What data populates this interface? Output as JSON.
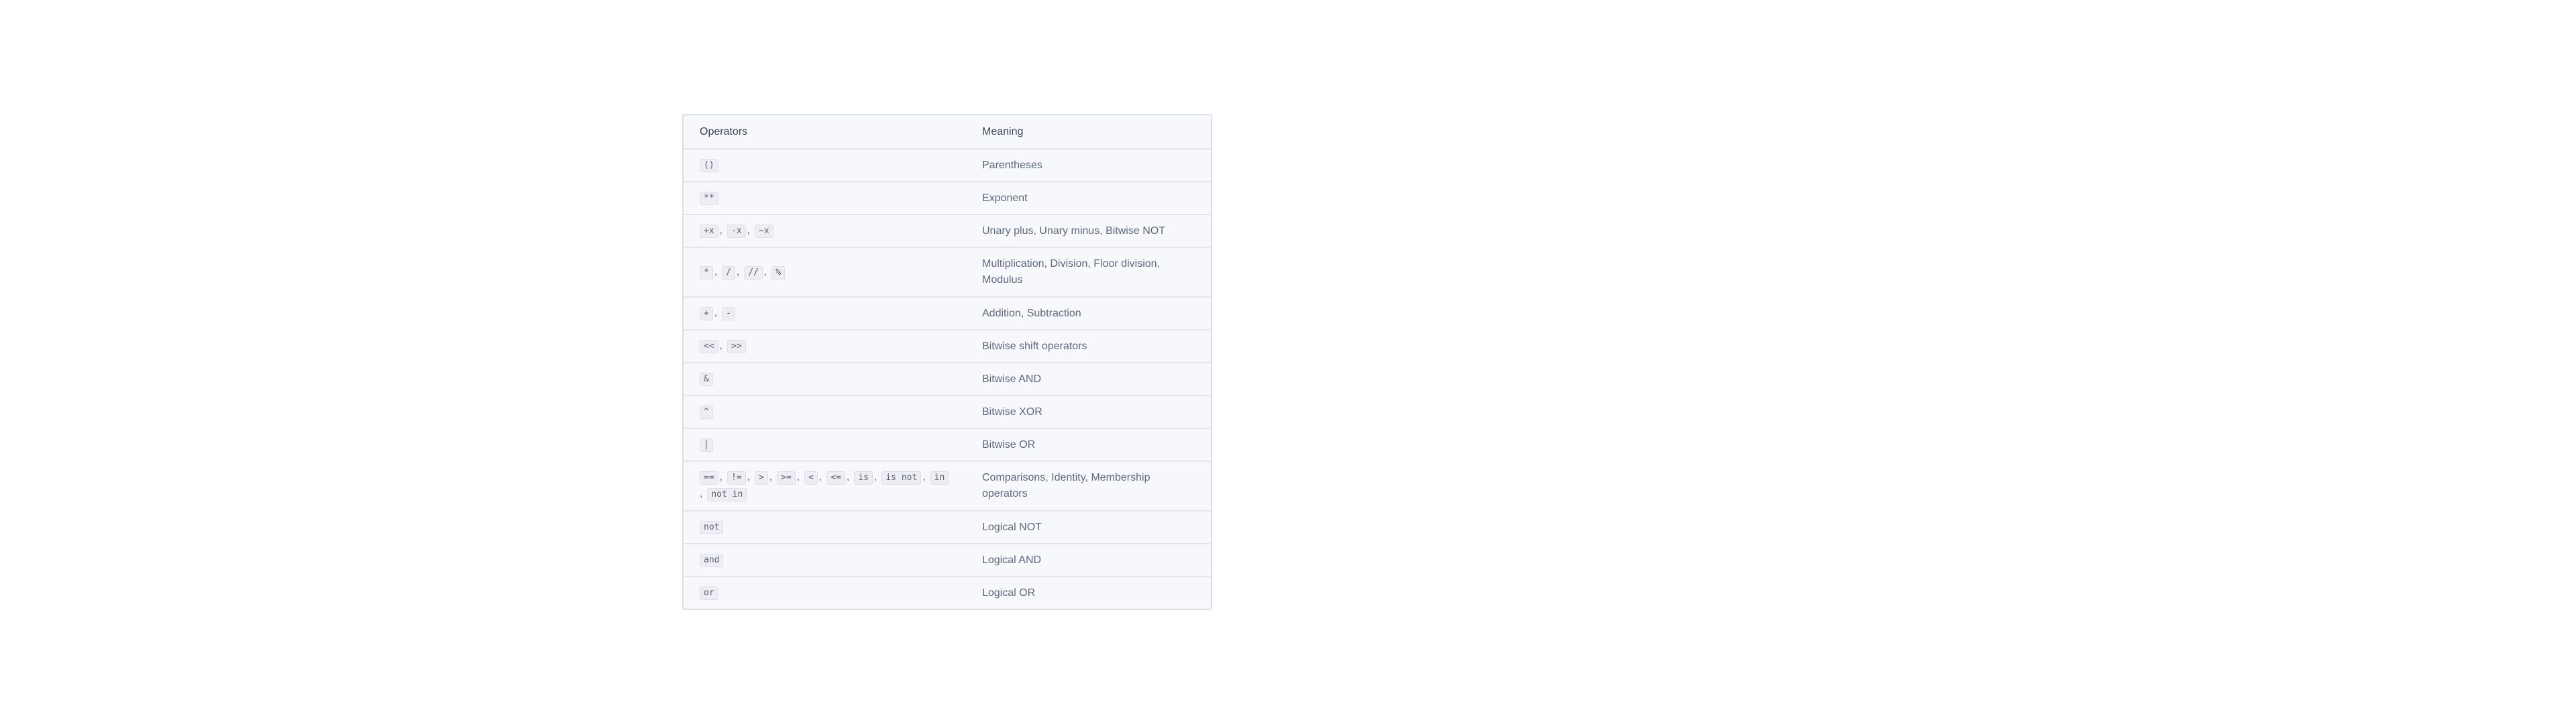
{
  "table": {
    "header": {
      "operators": "Operators",
      "meaning": "Meaning"
    },
    "rows": [
      {
        "ops": [
          "()"
        ],
        "meaning": "Parentheses"
      },
      {
        "ops": [
          "**"
        ],
        "meaning": "Exponent"
      },
      {
        "ops": [
          "+x",
          "-x",
          "~x"
        ],
        "meaning": "Unary plus, Unary minus, Bitwise NOT"
      },
      {
        "ops": [
          "*",
          "/",
          "//",
          "%"
        ],
        "meaning": "Multiplication, Division, Floor division, Modulus"
      },
      {
        "ops": [
          "+",
          "-"
        ],
        "meaning": "Addition, Subtraction"
      },
      {
        "ops": [
          "<<",
          ">>"
        ],
        "meaning": "Bitwise shift operators"
      },
      {
        "ops": [
          "&"
        ],
        "meaning": "Bitwise AND"
      },
      {
        "ops": [
          "^"
        ],
        "meaning": "Bitwise XOR"
      },
      {
        "ops": [
          "|"
        ],
        "meaning": "Bitwise OR"
      },
      {
        "ops": [
          "==",
          "!=",
          ">",
          ">=",
          "<",
          "<=",
          "is",
          "is not",
          "in",
          "not in"
        ],
        "meaning": "Comparisons, Identity, Membership operators"
      },
      {
        "ops": [
          "not"
        ],
        "meaning": "Logical NOT"
      },
      {
        "ops": [
          "and"
        ],
        "meaning": "Logical AND"
      },
      {
        "ops": [
          "or"
        ],
        "meaning": "Logical OR"
      }
    ]
  }
}
